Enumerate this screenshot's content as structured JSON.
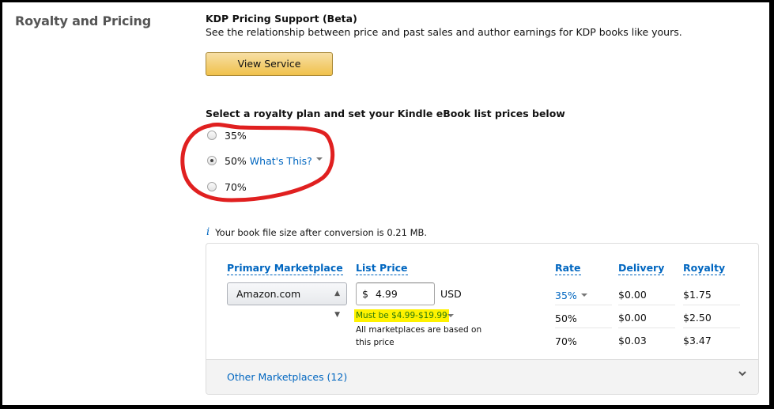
{
  "section": {
    "title": "Royalty and Pricing"
  },
  "pricing_support": {
    "title": "KDP Pricing Support (Beta)",
    "description": "See the relationship between price and past sales and author earnings for KDP books like yours.",
    "button_label": "View Service"
  },
  "royalty_plan": {
    "label": "Select a royalty plan and set your Kindle eBook list prices below",
    "options": [
      {
        "label": "35%",
        "selected": false
      },
      {
        "label": "50%",
        "selected": true,
        "help_link": "What's This?"
      },
      {
        "label": "70%",
        "selected": false
      }
    ]
  },
  "annotation": {
    "color": "#e02020",
    "shape": "freehand-circle-around-royalty-options"
  },
  "file_info": {
    "icon": "info-icon",
    "text": "Your book file size after conversion is 0.21 MB."
  },
  "pricing_table": {
    "headers": {
      "marketplace": "Primary Marketplace",
      "list_price": "List Price",
      "rate": "Rate",
      "delivery": "Delivery",
      "royalty": "Royalty"
    },
    "marketplace_value": "Amazon.com",
    "price_currency_symbol": "$",
    "price_value": "4.99",
    "currency": "USD",
    "price_range_note": "Must be $4.99-$19.99",
    "marketplace_note": "All marketplaces are based on this price",
    "rows": [
      {
        "rate": "35%",
        "delivery": "$0.00",
        "royalty": "$1.75",
        "active": true
      },
      {
        "rate": "50%",
        "delivery": "$0.00",
        "royalty": "$2.50",
        "active": false
      },
      {
        "rate": "70%",
        "delivery": "$0.03",
        "royalty": "$3.47",
        "active": false
      }
    ],
    "other_marketplaces_label": "Other Marketplaces (12)"
  },
  "colors": {
    "link": "#0066c0",
    "button_gradient_top": "#f7dfa5",
    "button_gradient_bottom": "#f0c14b",
    "highlight": "#fff200",
    "note_green": "#2b7a0b"
  }
}
